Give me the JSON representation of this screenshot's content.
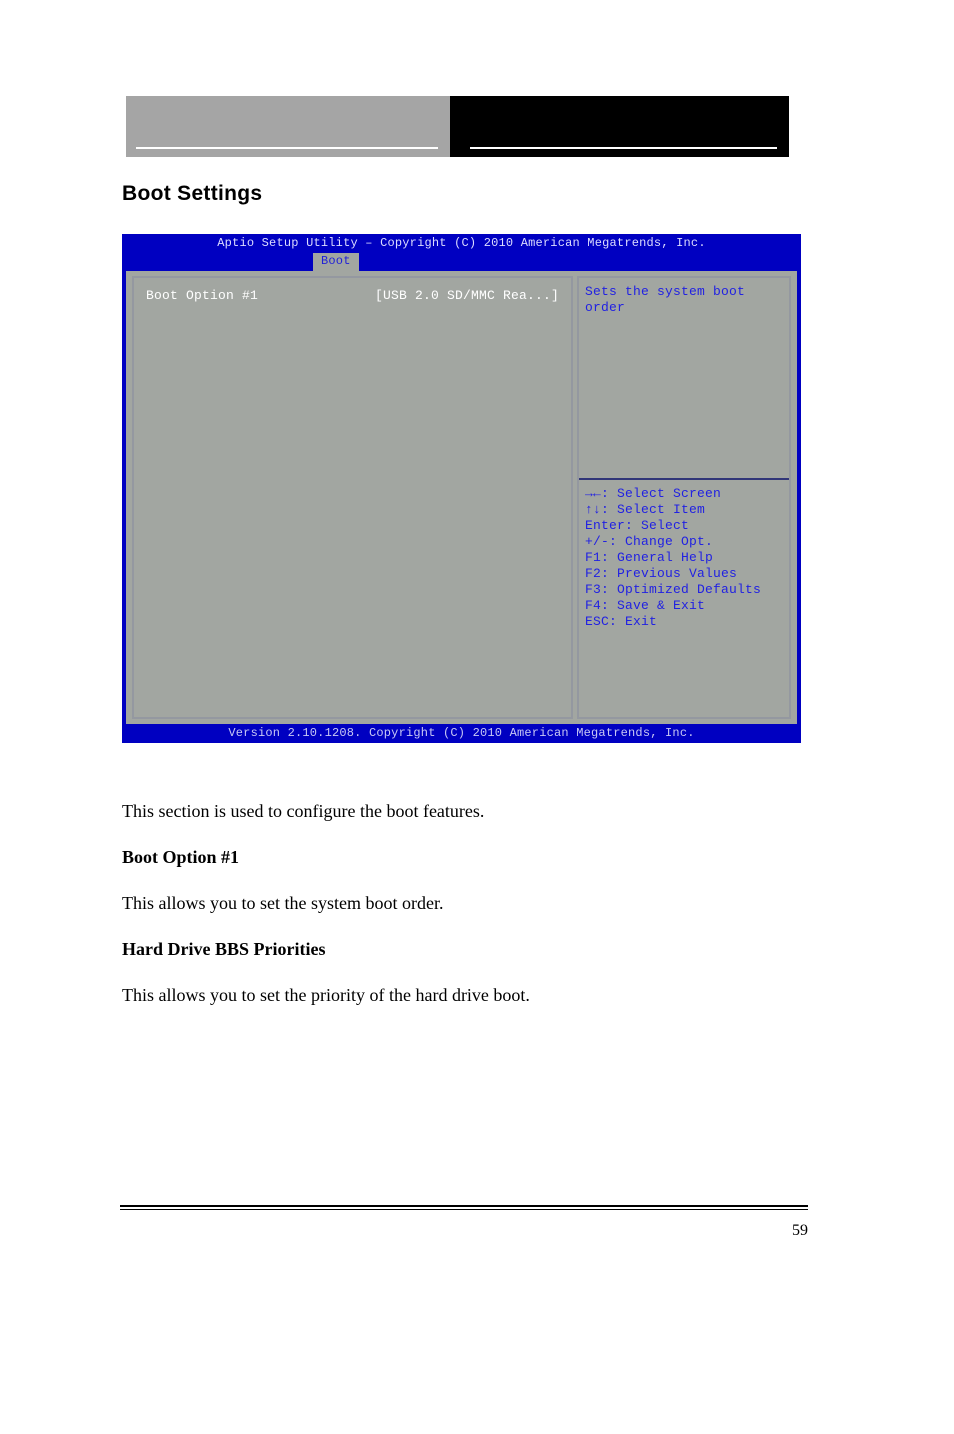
{
  "doc": {
    "heading": "Boot Settings",
    "para1": "This section is used to configure the boot features.",
    "h_opt1": "Boot Option #1",
    "p_opt1": "This allows you to set the system boot order.",
    "h_group": "Hard Drive BBS Priorities",
    "p_group": "This allows you to set the priority of the hard drive boot.",
    "page": "59"
  },
  "bios": {
    "title": "Aptio Setup Utility – Copyright (C) 2010 American Megatrends, Inc.",
    "tab": "Boot",
    "option_label": "Boot Option #1",
    "option_value": "[USB 2.0 SD/MMC Rea...]",
    "help": "Sets the system boot order",
    "keys": "→←: Select Screen\n↑↓: Select Item\nEnter: Select\n+/-: Change Opt.\nF1: General Help\nF2: Previous Values\nF3: Optimized Defaults\nF4: Save & Exit\nESC: Exit",
    "version": "Version 2.10.1208. Copyright (C) 2010 American Megatrends, Inc."
  }
}
